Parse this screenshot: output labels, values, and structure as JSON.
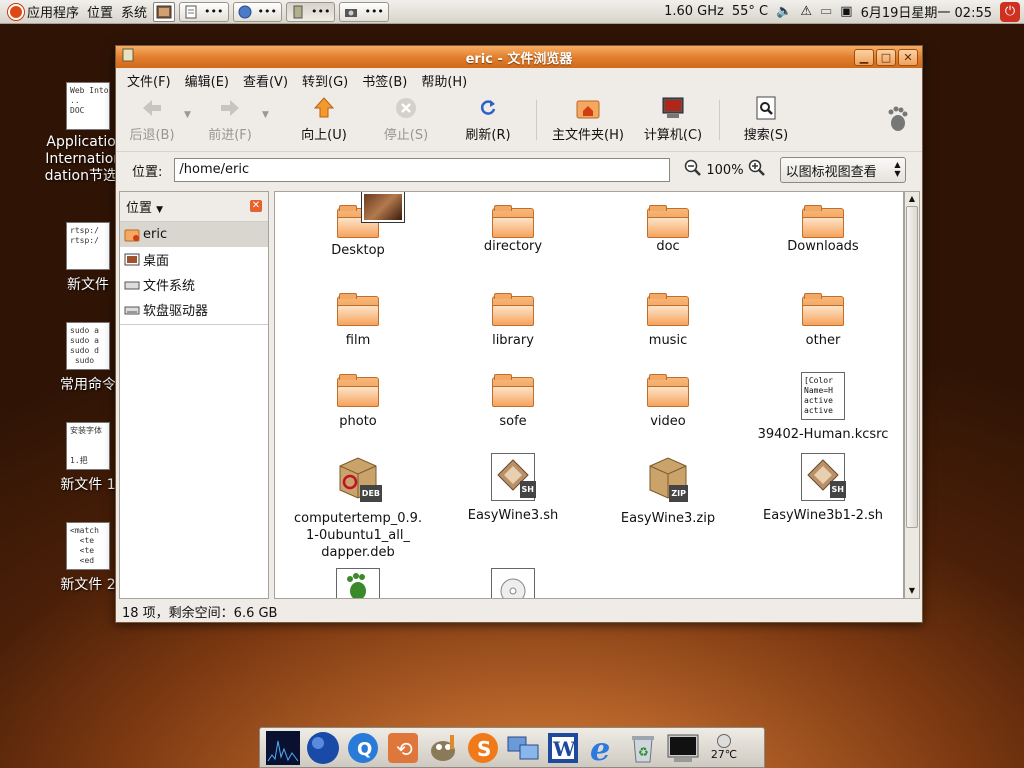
{
  "top_panel": {
    "menus": [
      "应用程序",
      "位置",
      "系统"
    ],
    "cpu": "1.60 GHz",
    "temp": "55° C",
    "datetime": "6月19日星期一 02:55"
  },
  "desktop_icons": [
    {
      "label": "Applicationf Internationa dation节选[2",
      "thumb": "Web Into.\n..\nDOC"
    },
    {
      "label": "新文件",
      "thumb": "rtsp:/\nrtsp:/"
    },
    {
      "label": "常用命令",
      "thumb": "sudo a\nsudo a\nsudo d\n sudo"
    },
    {
      "label": "新文件 1",
      "thumb": "安装字体\n\n\n1.把"
    },
    {
      "label": "新文件 2",
      "thumb": "<match\n  <te\n  <te\n  <ed"
    }
  ],
  "window": {
    "title": "eric - 文件浏览器",
    "menus": [
      "文件(F)",
      "编辑(E)",
      "查看(V)",
      "转到(G)",
      "书签(B)",
      "帮助(H)"
    ],
    "toolbar": {
      "back": "后退(B)",
      "forward": "前进(F)",
      "up": "向上(U)",
      "stop": "停止(S)",
      "reload": "刷新(R)",
      "home": "主文件夹(H)",
      "computer": "计算机(C)",
      "search": "搜索(S)"
    },
    "location_label": "位置:",
    "location_value": "/home/eric",
    "zoom": "100%",
    "view_mode": "以图标视图查看",
    "sidebar": {
      "title": "位置",
      "items": [
        "eric",
        "桌面",
        "文件系统",
        "软盘驱动器"
      ]
    },
    "files": [
      {
        "name": "Desktop",
        "type": "folder"
      },
      {
        "name": "directory",
        "type": "folder"
      },
      {
        "name": "doc",
        "type": "folder"
      },
      {
        "name": "Downloads",
        "type": "folder"
      },
      {
        "name": "film",
        "type": "folder"
      },
      {
        "name": "library",
        "type": "folder"
      },
      {
        "name": "music",
        "type": "folder"
      },
      {
        "name": "other",
        "type": "folder"
      },
      {
        "name": "photo",
        "type": "folder"
      },
      {
        "name": "sofe",
        "type": "folder"
      },
      {
        "name": "video",
        "type": "folder"
      },
      {
        "name": "39402-Human.kcsrc",
        "type": "text",
        "preview": "[Color\nName=H\nactive\nactive"
      },
      {
        "name": "computertemp_0.9.1-0ubuntu1_all_dapper.deb",
        "name_lines": [
          "computertemp_0.9.",
          "1-0ubuntu1_all_",
          "dapper.deb"
        ],
        "type": "deb",
        "badge": "DEB"
      },
      {
        "name": "EasyWine3.sh",
        "type": "sh",
        "badge": "SH"
      },
      {
        "name": "EasyWine3.zip",
        "type": "zip",
        "badge": "ZIP"
      },
      {
        "name": "EasyWine3b1-2.sh",
        "type": "sh",
        "badge": "SH"
      }
    ],
    "status": "18 项，剩余空间：6.6 GB"
  },
  "dock": {
    "temperature": "27℃"
  },
  "colors": {
    "title_orange": "#e07c2a",
    "folder_orange": "#f6a45e",
    "ubuntu_red": "#dd4814"
  }
}
